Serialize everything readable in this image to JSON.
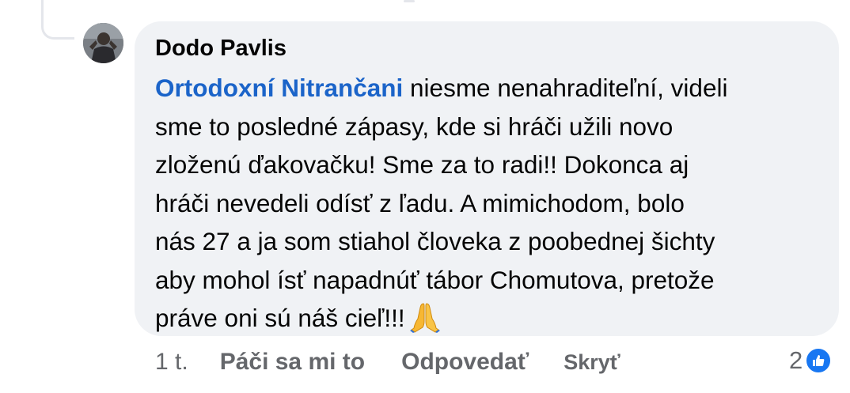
{
  "comment": {
    "author": "Dodo Pavlis",
    "mention": "Ortodoxní Nitrančani",
    "lines": [
      " niesme nenahraditeľní, videli",
      "sme to posledné zápasy, kde si hráči užili novo",
      "zloženú ďakovačku! Sme za to radi!! Dokonca aj",
      "hráči nevedeli odísť z ľadu. A mimichodom, bolo",
      "nás 27 a ja som stiahol človeka z poobednej šichty",
      "aby mohol ísť napadnúť tábor Chomutova, pretože",
      "práve oni sú náš cieľ!!!"
    ],
    "emoji_icon": "folded-hands-emoji"
  },
  "actions": {
    "time": "1 t.",
    "like_label": "Páči sa mi to",
    "reply_label": "Odpovedať",
    "hide_label": "Skryť"
  },
  "reactions": {
    "count": "2",
    "icon": "like-icon"
  },
  "colors": {
    "bubble_bg": "#f0f2f5",
    "mention": "#1b64c9",
    "meta_text": "#65676b",
    "like_badge": "#1877f2"
  }
}
